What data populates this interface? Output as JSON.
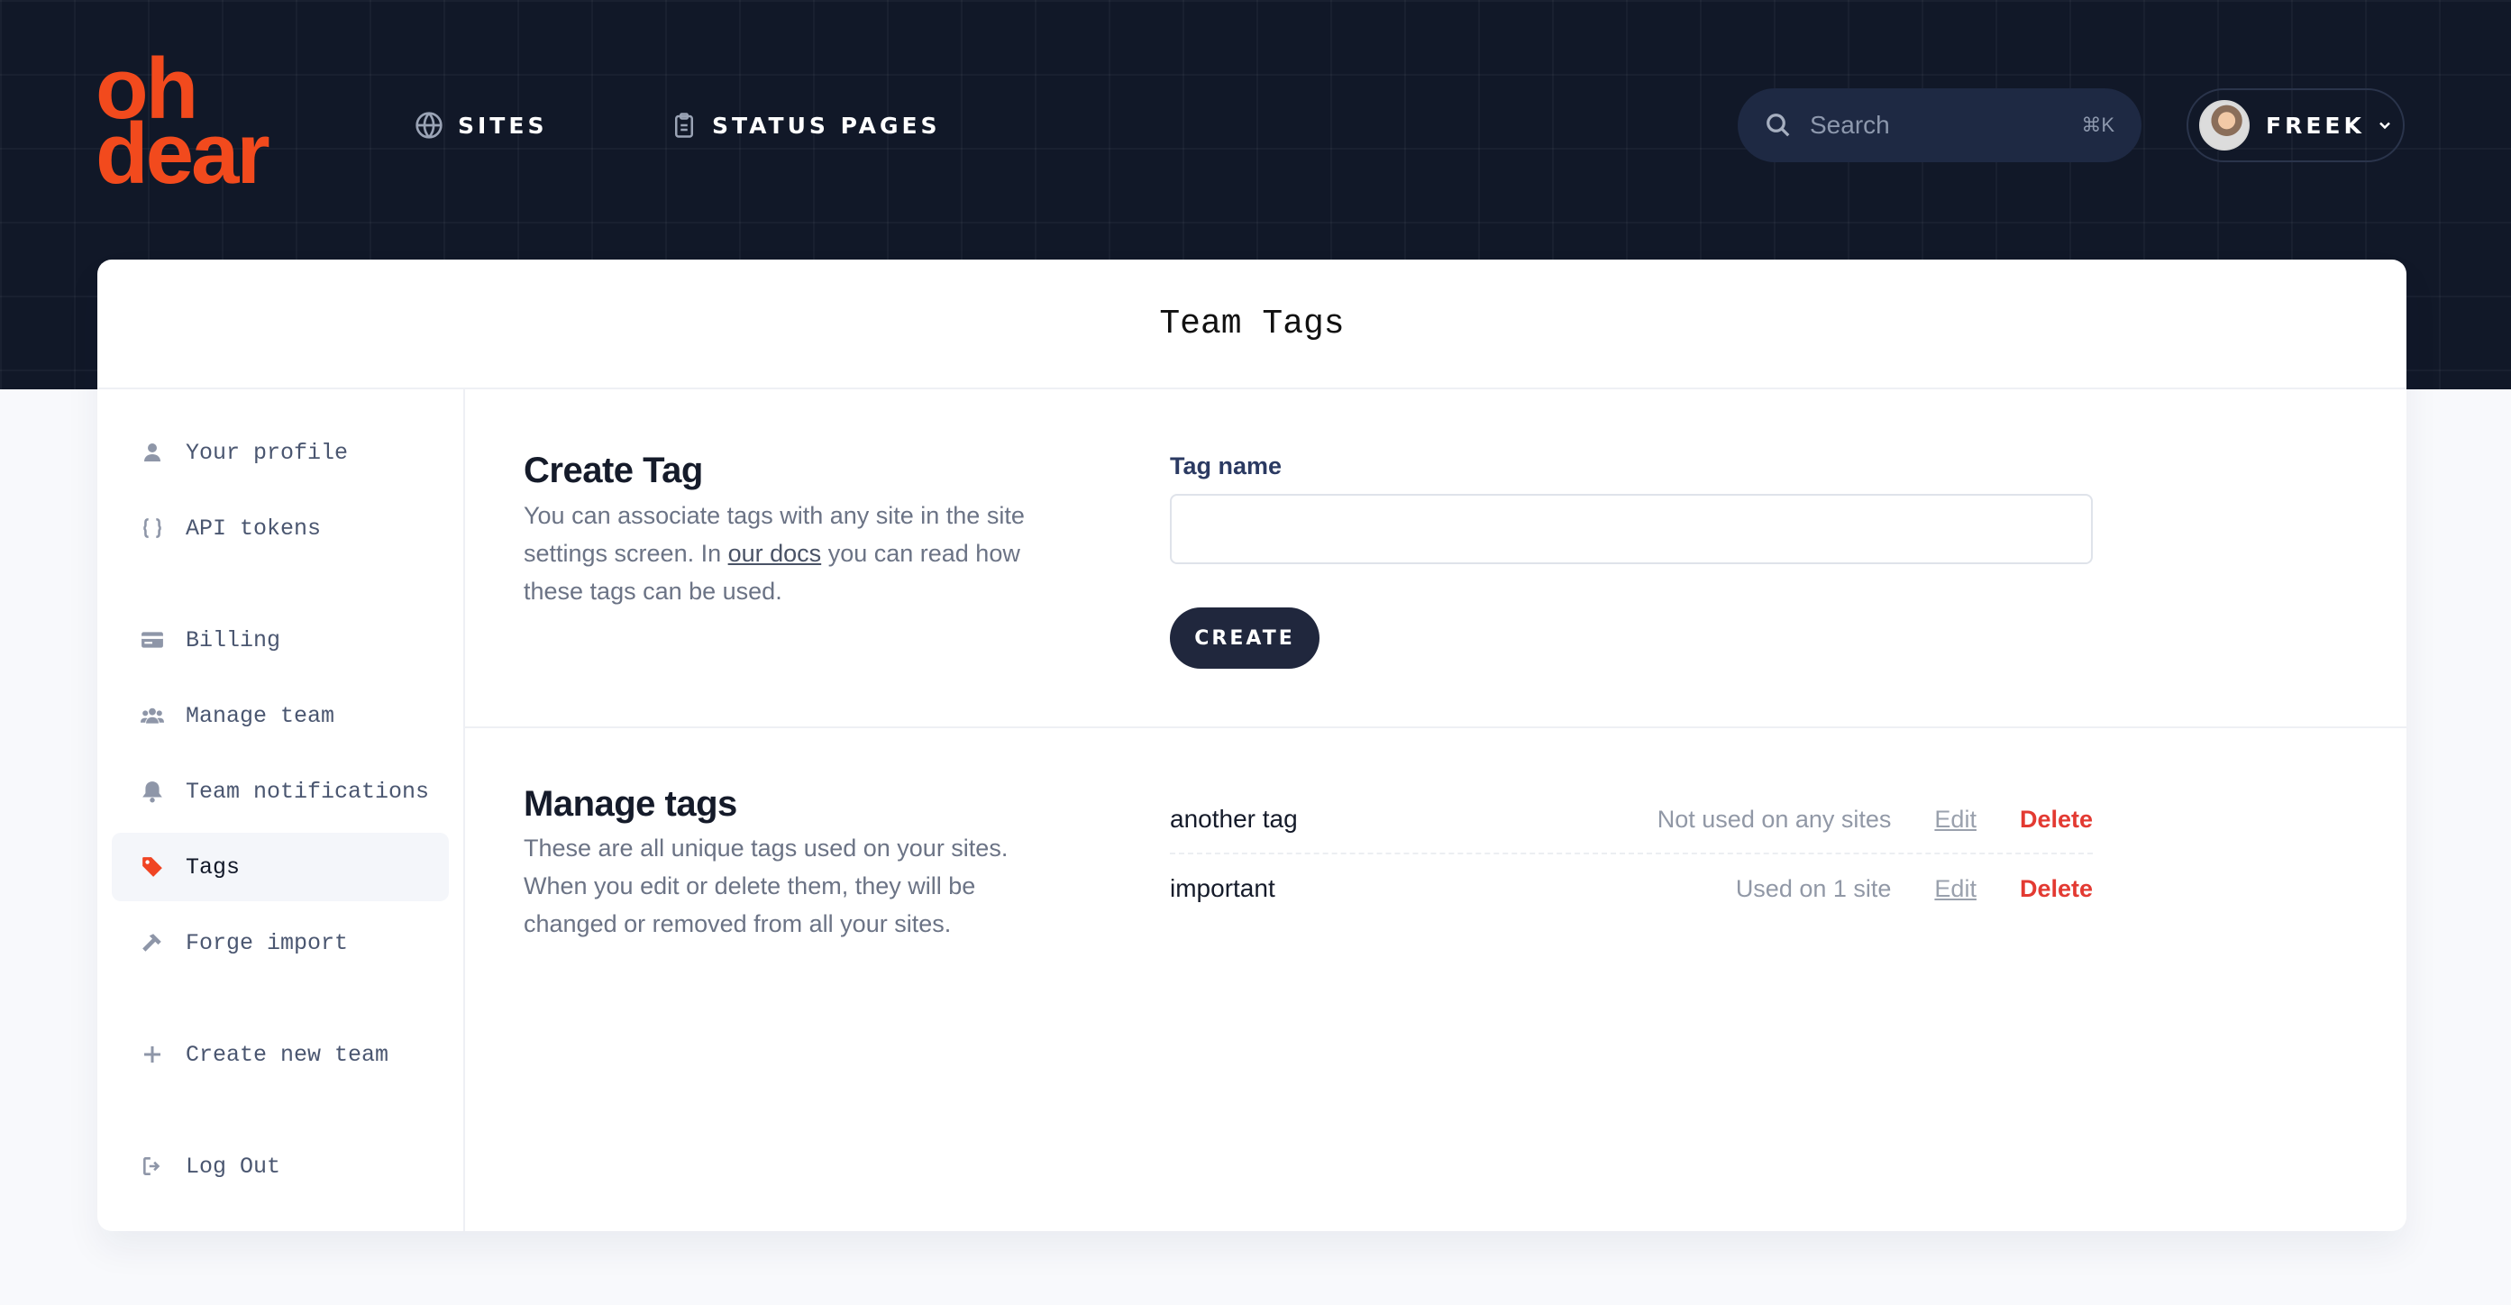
{
  "brand": {
    "line1": "oh",
    "line2": "dear",
    "color": "#f24a1d"
  },
  "nav": {
    "sites": "SITES",
    "status_pages": "STATUS PAGES"
  },
  "search": {
    "placeholder": "Search",
    "shortcut": "⌘K"
  },
  "user": {
    "name": "FREEK"
  },
  "page": {
    "title": "Team Tags"
  },
  "sidebar": {
    "items": [
      {
        "label": "Your profile",
        "icon": "user-icon"
      },
      {
        "label": "API tokens",
        "icon": "braces-icon"
      },
      {
        "label": "Billing",
        "icon": "credit-card-icon"
      },
      {
        "label": "Manage team",
        "icon": "users-icon"
      },
      {
        "label": "Team notifications",
        "icon": "bell-icon"
      },
      {
        "label": "Tags",
        "icon": "tag-icon",
        "active": true
      },
      {
        "label": "Forge import",
        "icon": "hammer-icon"
      },
      {
        "label": "Create new team",
        "icon": "plus-icon"
      },
      {
        "label": "Log Out",
        "icon": "logout-icon"
      }
    ]
  },
  "create_tag": {
    "title": "Create Tag",
    "desc_before": "You can associate tags with any site in the site settings screen. In ",
    "desc_link": "our docs",
    "desc_after": " you can read how these tags can be used.",
    "field_label": "Tag name",
    "field_value": "",
    "button": "CREATE"
  },
  "manage_tags": {
    "title": "Manage tags",
    "desc": "These are all unique tags used on your sites. When you edit or delete them, they will be changed or removed from all your sites.",
    "rows": [
      {
        "name": "another tag",
        "usage": "Not used on any sites",
        "edit": "Edit",
        "delete": "Delete"
      },
      {
        "name": "important",
        "usage": "Used on 1 site",
        "edit": "Edit",
        "delete": "Delete"
      }
    ]
  },
  "colors": {
    "header_bg": "#111828",
    "button_bg": "#20273d",
    "delete": "#e33a32",
    "label": "#2b3a62"
  }
}
